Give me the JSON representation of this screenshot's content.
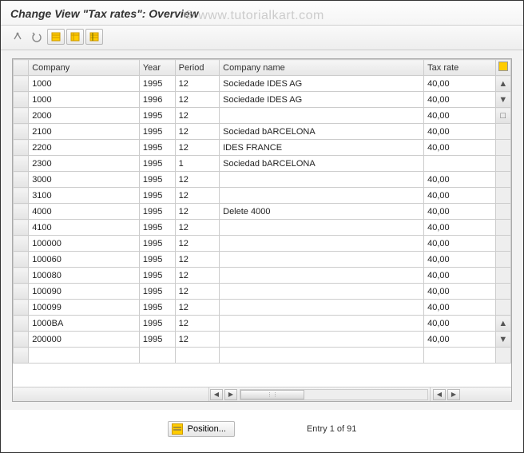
{
  "header": {
    "title": "Change View \"Tax rates\": Overview"
  },
  "watermark": "© www.tutorialkart.com",
  "toolbar": {
    "items": [
      {
        "name": "other-view-icon"
      },
      {
        "name": "undo-icon"
      },
      {
        "name": "new-entries-icon"
      },
      {
        "name": "copy-icon"
      },
      {
        "name": "delete-icon"
      }
    ]
  },
  "table": {
    "columns": {
      "company": "Company",
      "year": "Year",
      "period": "Period",
      "company_name": "Company name",
      "tax_rate": "Tax rate"
    },
    "rows": [
      {
        "company": "1000",
        "year": "1995",
        "period": "12",
        "name": "Sociedade IDES AG",
        "tax": "40,00"
      },
      {
        "company": "1000",
        "year": "1996",
        "period": "12",
        "name": "Sociedade IDES AG",
        "tax": "40,00"
      },
      {
        "company": "2000",
        "year": "1995",
        "period": "12",
        "name": "",
        "tax": "40,00"
      },
      {
        "company": "2100",
        "year": "1995",
        "period": "12",
        "name": "Sociedad bARCELONA",
        "tax": "40,00"
      },
      {
        "company": "2200",
        "year": "1995",
        "period": "12",
        "name": "IDES FRANCE",
        "tax": "40,00"
      },
      {
        "company": "2300",
        "year": "1995",
        "period": "1",
        "name": "Sociedad bARCELONA",
        "tax": ""
      },
      {
        "company": "3000",
        "year": "1995",
        "period": "12",
        "name": "",
        "tax": "40,00"
      },
      {
        "company": "3100",
        "year": "1995",
        "period": "12",
        "name": "",
        "tax": "40,00"
      },
      {
        "company": "4000",
        "year": "1995",
        "period": "12",
        "name": "Delete 4000",
        "tax": "40,00"
      },
      {
        "company": "4100",
        "year": "1995",
        "period": "12",
        "name": "",
        "tax": "40,00"
      },
      {
        "company": "100000",
        "year": "1995",
        "period": "12",
        "name": "",
        "tax": "40,00"
      },
      {
        "company": "100060",
        "year": "1995",
        "period": "12",
        "name": "",
        "tax": "40,00"
      },
      {
        "company": "100080",
        "year": "1995",
        "period": "12",
        "name": "",
        "tax": "40,00"
      },
      {
        "company": "100090",
        "year": "1995",
        "period": "12",
        "name": "",
        "tax": "40,00"
      },
      {
        "company": "100099",
        "year": "1995",
        "period": "12",
        "name": "",
        "tax": "40,00"
      },
      {
        "company": "1000BA",
        "year": "1995",
        "period": "12",
        "name": "",
        "tax": "40,00"
      },
      {
        "company": "200000",
        "year": "1995",
        "period": "12",
        "name": "",
        "tax": "40,00"
      }
    ]
  },
  "footer": {
    "position_label": "Position...",
    "entry_text": "Entry 1 of 91"
  }
}
